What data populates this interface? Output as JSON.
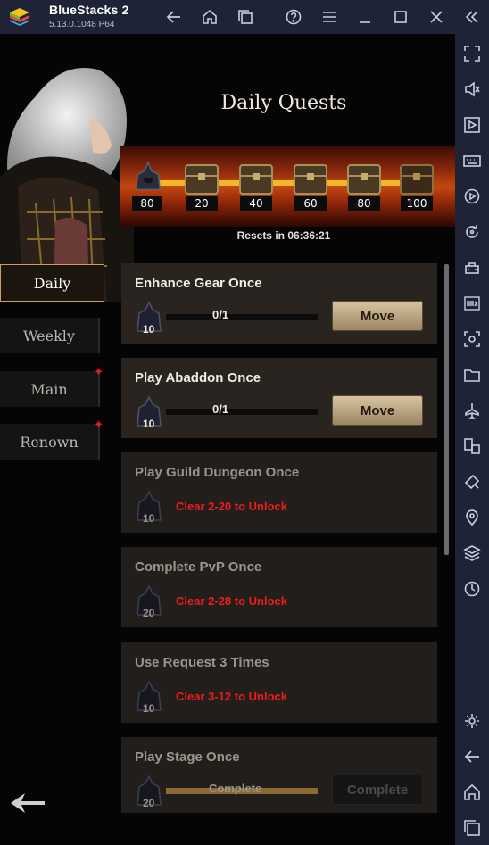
{
  "window": {
    "app_name": "BlueStacks 2",
    "version": "5.13.0.1048  P64"
  },
  "colors": {
    "chrome": "#1e2436",
    "gold": "#f2b629",
    "lock_red": "#ee1c1c",
    "tab_active_border": "#c6a15a"
  },
  "titlebar_icons": [
    "back-icon",
    "home-icon",
    "multi-instance-icon",
    "help-icon",
    "menu-icon",
    "minimize-icon",
    "maximize-icon",
    "close-icon",
    "collapse-sidebar-icon"
  ],
  "sidebar_icons": [
    "fullscreen-icon",
    "volume-icon",
    "media-manager-icon",
    "keyboard-icon",
    "record-icon",
    "rotate-icon",
    "game-controls-icon",
    "install-apk-icon",
    "screenshot-icon",
    "folder-icon",
    "airplane-mode-icon",
    "multi-window-icon",
    "eco-mode-icon",
    "location-icon",
    "layers-icon",
    "macro-icon",
    "settings-icon",
    "android-back-icon",
    "android-home-icon",
    "recent-apps-icon"
  ],
  "screen": {
    "title": "Daily Quests",
    "milestones": [
      {
        "label": "80",
        "kind": "helmet"
      },
      {
        "label": "20",
        "kind": "chest"
      },
      {
        "label": "40",
        "kind": "chest"
      },
      {
        "label": "60",
        "kind": "chest"
      },
      {
        "label": "80",
        "kind": "chest"
      },
      {
        "label": "100",
        "kind": "chest"
      }
    ],
    "milestone_progress": 0.8,
    "resets_text": "Resets in 06:36:21",
    "tabs": [
      {
        "label": "Daily",
        "active": true,
        "badge": false
      },
      {
        "label": "Weekly",
        "active": false,
        "badge": false
      },
      {
        "label": "Main",
        "active": false,
        "badge": true
      },
      {
        "label": "Renown",
        "active": false,
        "badge": true
      }
    ],
    "badge_glyph": "✦",
    "quests": [
      {
        "title": "Enhance Gear Once",
        "reward": "10",
        "progress": "0/1",
        "progress_fraction": 0,
        "button": "Move",
        "state": "active",
        "lock_text": ""
      },
      {
        "title": "Play Abaddon Once",
        "reward": "10",
        "progress": "0/1",
        "progress_fraction": 0,
        "button": "Move",
        "state": "active",
        "lock_text": ""
      },
      {
        "title": "Play Guild Dungeon Once",
        "reward": "10",
        "progress": "",
        "progress_fraction": 0,
        "button": "",
        "state": "locked",
        "lock_text": "Clear 2-20 to Unlock"
      },
      {
        "title": "Complete PvP Once",
        "reward": "20",
        "progress": "",
        "progress_fraction": 0,
        "button": "",
        "state": "locked",
        "lock_text": "Clear 2-28 to Unlock"
      },
      {
        "title": "Use Request 3 Times",
        "reward": "10",
        "progress": "",
        "progress_fraction": 0,
        "button": "",
        "state": "locked",
        "lock_text": "Clear 3-12 to Unlock"
      },
      {
        "title": "Play Stage Once",
        "reward": "20",
        "progress": "Complete",
        "progress_fraction": 1,
        "button": "Complete",
        "state": "done",
        "lock_text": ""
      }
    ]
  }
}
